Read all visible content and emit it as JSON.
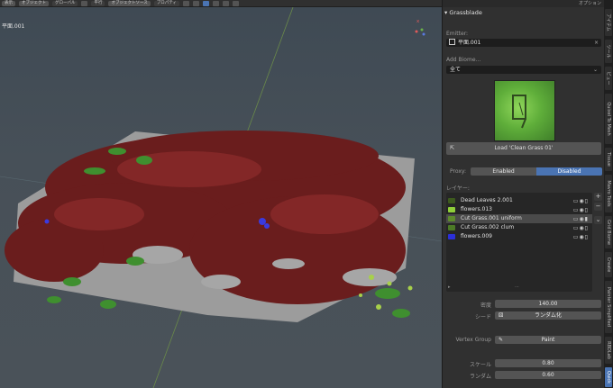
{
  "header": {
    "items": [
      "表示",
      "オブジェクト",
      "グローバル",
      "平行",
      "オブジェクトソース",
      "プロパティ",
      "オプション"
    ]
  },
  "viewport": {
    "object_label": "平面.001",
    "gizmo_axis": "x"
  },
  "panel": {
    "top_right_label": "オプション",
    "header_title": "Grassblade",
    "emitter_label": "Emitter:",
    "emitter_value": "平面.001",
    "biome_label": "Add Biome...",
    "biome_value": "全て",
    "load_button": "Load 'Clean Grass 01'",
    "proxy_label": "Proxy:",
    "proxy_enabled": "Enabled",
    "proxy_disabled": "Disabled",
    "layers_label": "レイヤー:",
    "layers": [
      {
        "name": "Dead Leaves 2.001",
        "color": "#3d5a1e"
      },
      {
        "name": "flowers.013",
        "color": "#8fcf3a"
      },
      {
        "name": "Cut Grass.001 uniform",
        "color": "#5e8b2c"
      },
      {
        "name": "Cut Grass.002 clum",
        "color": "#4c7a26"
      },
      {
        "name": "flowers.009",
        "color": "#2b2fd8"
      }
    ],
    "density_label": "密度",
    "density_value": "140.00",
    "seed_label": "シード",
    "seed_button": "ランダム化",
    "vgroup_label": "Vertex Group",
    "vgroup_button": "Paint",
    "scale_label": "スケール",
    "scale_value": "0.80",
    "random_label": "ランダム",
    "random_value": "0.60"
  },
  "tabs": [
    "アイテム",
    "ツール",
    "ビュー",
    "Quixel To Mesh",
    "Tissue",
    "Mavro Tools",
    "Grid Biome",
    "Create",
    "Painter Simplified",
    "RBDLab",
    "Quick"
  ],
  "colors": {
    "accent": "#4a74b3",
    "panel_bg": "#303030",
    "field_bg": "#1d1d1d",
    "foliage": "#6b1e1e",
    "ground": "#9c9c9c"
  }
}
